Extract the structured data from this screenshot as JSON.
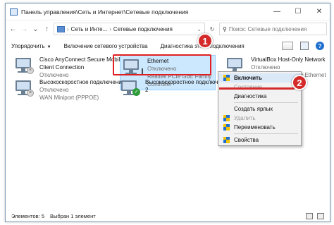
{
  "window": {
    "title": "Панель управления\\Сеть и Интернет\\Сетевые подключения",
    "min": "—",
    "max": "☐",
    "close": "✕"
  },
  "address": {
    "back": "←",
    "forward": "→",
    "up": "↑",
    "crumb1": "Сеть и Инте...",
    "crumb2": "Сетевые подключения",
    "search_placeholder": "Поиск: Сетевые подключения"
  },
  "toolbar": {
    "organize": "Упорядочить",
    "enable": "Включение сетевого устройства",
    "diagnose": "Диагностика этого подключения"
  },
  "connections": [
    {
      "name": "Cisco AnyConnect Secure Mobility",
      "name2": "Client Connection",
      "status": "Отключено",
      "device": ""
    },
    {
      "name": "Ethernet",
      "status": "Отключено",
      "device": "Realtek PCIe GbE Family Controller"
    },
    {
      "name": "VirtualBox Host-Only Network",
      "status": "Отключено",
      "device": "VirtualBox Host-Only Ethernet Ad..."
    },
    {
      "name": "Высокоскоростное подключение",
      "status": "Отключено",
      "device": "WAN Miniport (PPPOE)"
    },
    {
      "name": "Высокоскоростное подключение",
      "name2": "2",
      "status": "",
      "device": ""
    }
  ],
  "context_menu": {
    "items": [
      "Включить",
      "Состояние",
      "Диагностика",
      "Создать ярлык",
      "Удалить",
      "Переименовать",
      "Свойства"
    ]
  },
  "markers": [
    "1",
    "2"
  ],
  "status_bar": {
    "items_count": "Элементов: 5",
    "selected": "Выбран 1 элемент"
  },
  "colors": {
    "accent_red": "#d42a2a",
    "selection": "#cce8ff",
    "link_blue": "#1f6fcf"
  }
}
